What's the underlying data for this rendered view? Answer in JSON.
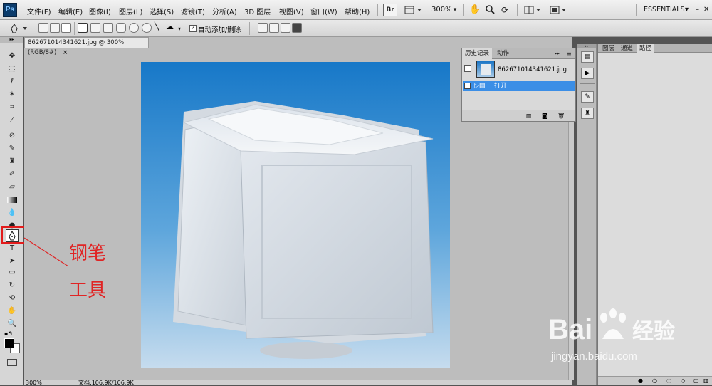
{
  "app": {
    "logo": "Ps"
  },
  "menu": [
    "文件(F)",
    "编辑(E)",
    "图像(I)",
    "图层(L)",
    "选择(S)",
    "滤镜(T)",
    "分析(A)",
    "3D 图层",
    "视图(V)",
    "窗口(W)",
    "帮助(H)"
  ],
  "appbar": {
    "br_label": "Br",
    "zoom": "300%",
    "workspace": "ESSENTIALS"
  },
  "options": {
    "auto_add_delete": "自动添加/删除"
  },
  "document": {
    "tab_title": "862671014341621.jpg @ 300%(RGB/8#)",
    "close_glyph": "×"
  },
  "status": {
    "zoom": "300%",
    "doc_size": "文档:106.9K/106.9K"
  },
  "history_panel": {
    "tabs": [
      "历史记录",
      "动作"
    ],
    "snapshot_name": "862671014341621.jpg",
    "states": [
      {
        "label": "打开",
        "selected": true
      }
    ]
  },
  "right_panel": {
    "tabs": [
      "图层",
      "通道",
      "路径"
    ],
    "active_tab": "路径"
  },
  "annotation": {
    "line1": "钢笔",
    "line2": "工具",
    "color": "#e02424"
  },
  "watermark": {
    "brand": "Bai",
    "brand2": "经验",
    "url": "jingyan.baidu.com"
  },
  "tools": [
    "move-tool",
    "marquee-tool",
    "lasso-tool",
    "magic-wand-tool",
    "crop-tool",
    "eyedropper-tool",
    "spot-healing-tool",
    "brush-tool",
    "clone-stamp-tool",
    "history-brush-tool",
    "eraser-tool",
    "gradient-tool",
    "blur-tool",
    "dodge-tool",
    "pen-tool",
    "type-tool",
    "path-selection-tool",
    "shape-tool",
    "3d-rotate-tool",
    "3d-orbit-tool",
    "hand-tool",
    "zoom-tool"
  ]
}
